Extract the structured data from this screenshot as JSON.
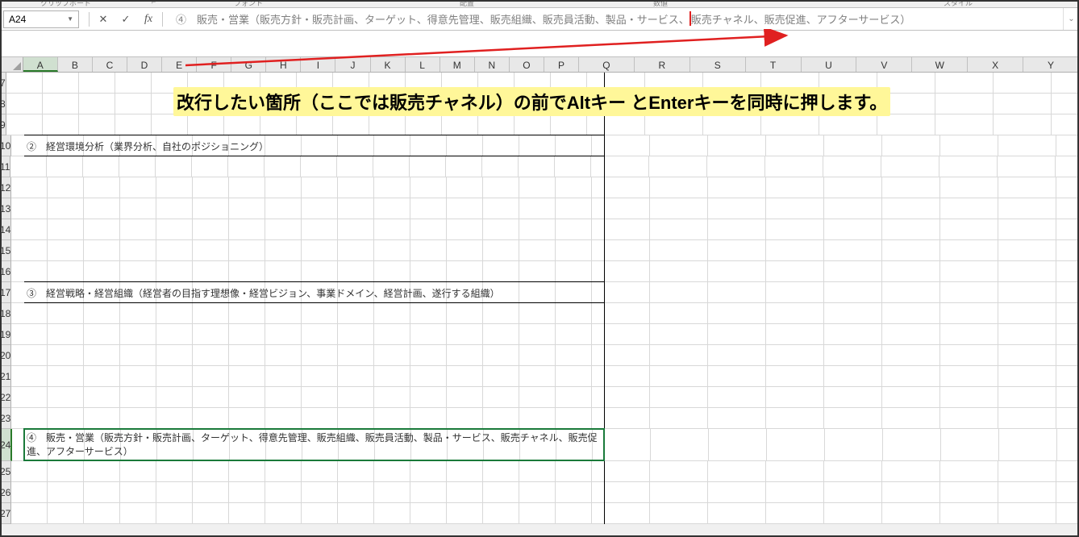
{
  "ribbon": {
    "labels": {
      "clipboard": "クリップボード",
      "font": "フォント",
      "alignment": "配置",
      "number": "数値",
      "styles": "スタイル"
    }
  },
  "nameBox": {
    "value": "A24"
  },
  "formulaBar": {
    "textBefore": "④　販売・営業（販売方針・販売計画、ターゲット、得意先管理、販売組織、販売員活動、製品・サービス、",
    "textAfter": "販売チャネル、販売促進、アフターサービス）"
  },
  "columns": [
    "A",
    "B",
    "C",
    "D",
    "E",
    "F",
    "G",
    "H",
    "I",
    "J",
    "K",
    "L",
    "M",
    "N",
    "O",
    "P",
    "Q",
    "R",
    "S",
    "T",
    "U",
    "V",
    "W",
    "X",
    "Y"
  ],
  "rows": [
    7,
    8,
    9,
    10,
    11,
    12,
    13,
    14,
    15,
    16,
    17,
    18,
    19,
    20,
    21,
    22,
    23,
    24,
    25,
    26,
    27
  ],
  "rowContent": {
    "10": "②　経営環境分析（業界分析、自社のポジショニング）",
    "17": "③　経営戦略・経営組織（経営者の目指す理想像・経営ビジョン、事業ドメイン、経営計画、遂行する組織）",
    "24": "④　販売・営業（販売方針・販売計画、ターゲット、得意先管理、販売組織、販売員活動、製品・サービス、販売チャネル、販売促進、アフターサービス）"
  },
  "selectedRow": 24,
  "annotation": "改行したい箇所（ここでは販売チャネル）の前でAltキー とEnterキーを同時に押します。"
}
